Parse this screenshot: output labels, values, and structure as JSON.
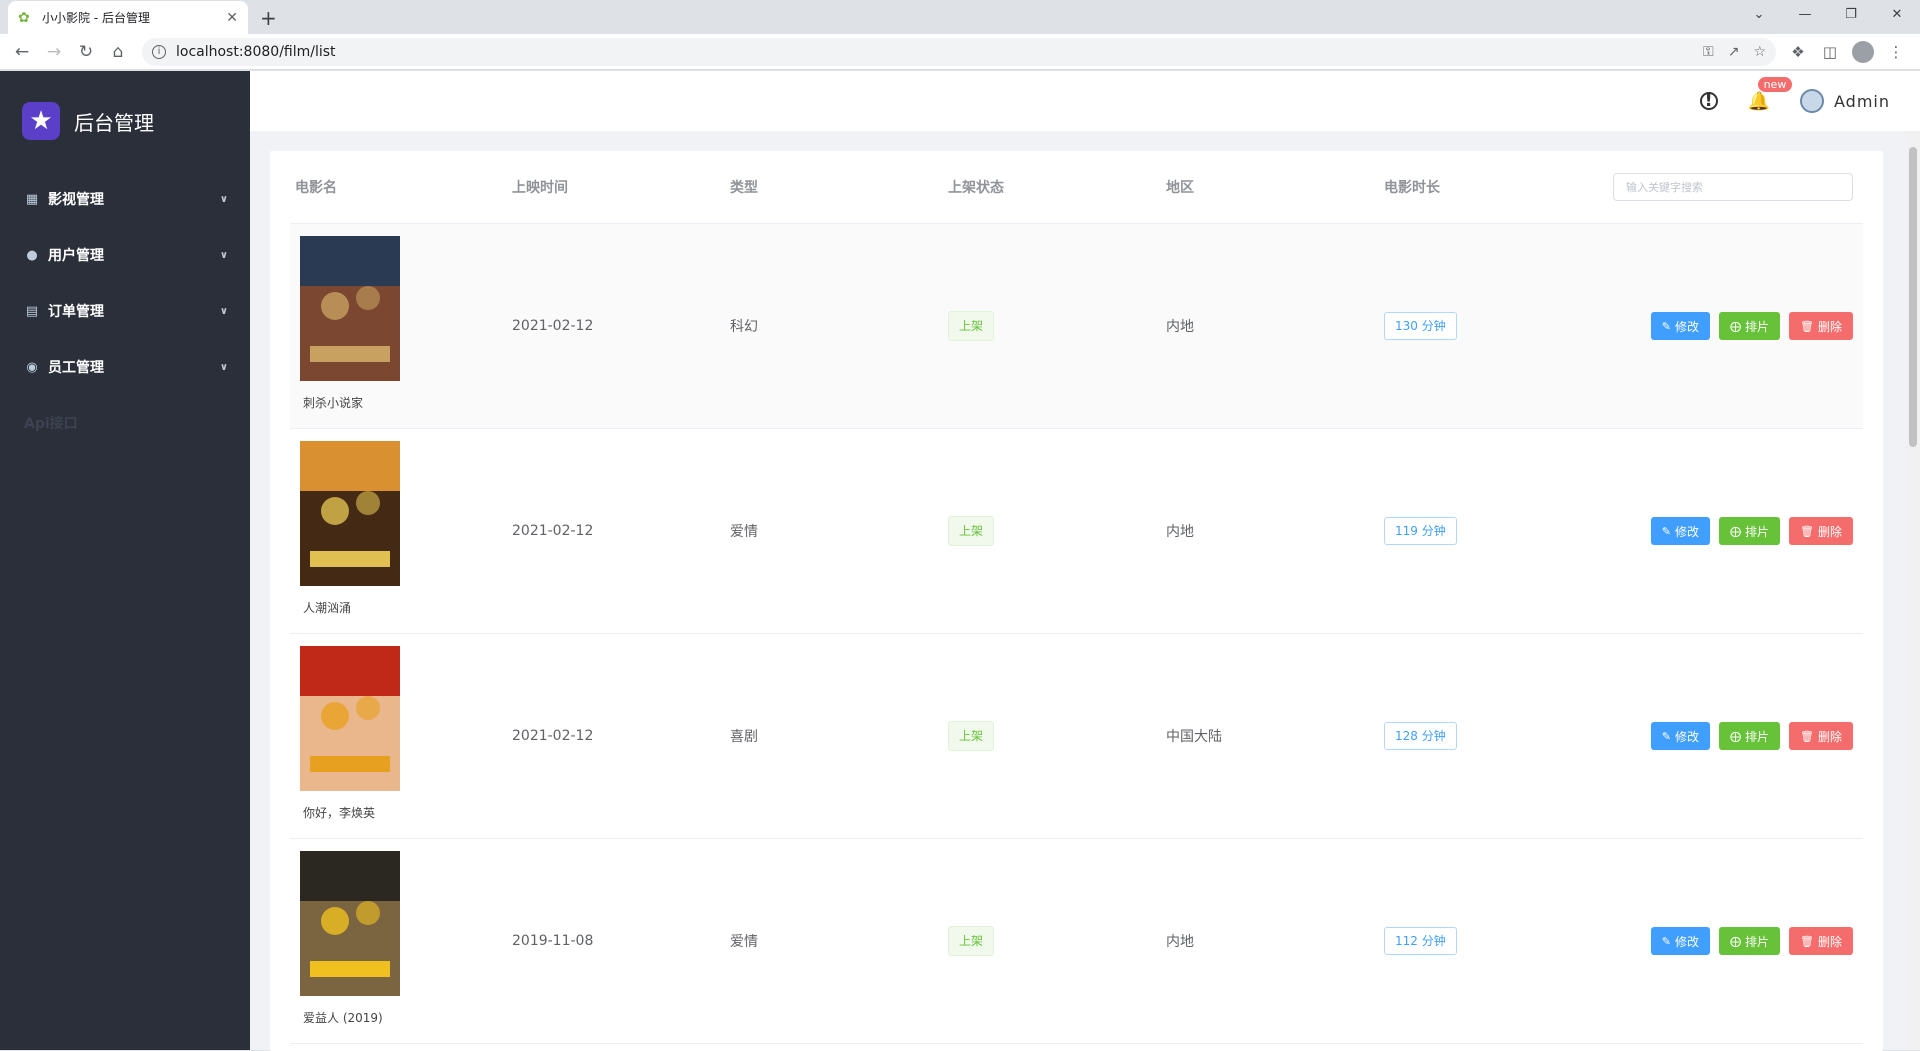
{
  "browser": {
    "tab_title": "小小影院 - 后台管理",
    "url": "localhost:8080/film/list"
  },
  "sidebar": {
    "brand": "后台管理",
    "items": [
      {
        "label": "影视管理",
        "icon": "grid-icon"
      },
      {
        "label": "用户管理",
        "icon": "user-icon"
      },
      {
        "label": "订单管理",
        "icon": "clipboard-icon"
      },
      {
        "label": "员工管理",
        "icon": "location-pin-icon"
      },
      {
        "label": "Api接口",
        "icon": ""
      }
    ]
  },
  "topbar": {
    "badge": "new",
    "username": "Admin"
  },
  "table": {
    "headers": {
      "name": "电影名",
      "date": "上映时间",
      "type": "类型",
      "status": "上架状态",
      "area": "地区",
      "length": "电影时长"
    },
    "search_placeholder": "输入关键字搜索",
    "buttons": {
      "edit": "修改",
      "schedule": "排片",
      "delete": "删除"
    },
    "rows": [
      {
        "name": "刺杀小说家",
        "date": "2021-02-12",
        "type": "科幻",
        "status": "上架",
        "area": "内地",
        "length": "130 分钟",
        "poster_colors": [
          "#2a3a52",
          "#8a4a2a",
          "#c8a060"
        ]
      },
      {
        "name": "人潮汹涌",
        "date": "2021-02-12",
        "type": "爱情",
        "status": "上架",
        "area": "内地",
        "length": "119 分钟",
        "poster_colors": [
          "#d89030",
          "#2a1810",
          "#e0c050"
        ]
      },
      {
        "name": "你好，李焕英",
        "date": "2021-02-12",
        "type": "喜剧",
        "status": "上架",
        "area": "中国大陆",
        "length": "128 分钟",
        "poster_colors": [
          "#c02818",
          "#f0d0a0",
          "#e8a020"
        ]
      },
      {
        "name": "爱益人 (2019)",
        "date": "2019-11-08",
        "type": "爱情",
        "status": "上架",
        "area": "内地",
        "length": "112 分钟",
        "poster_colors": [
          "#2a2820",
          "#8a7048",
          "#f0c020"
        ]
      }
    ]
  }
}
